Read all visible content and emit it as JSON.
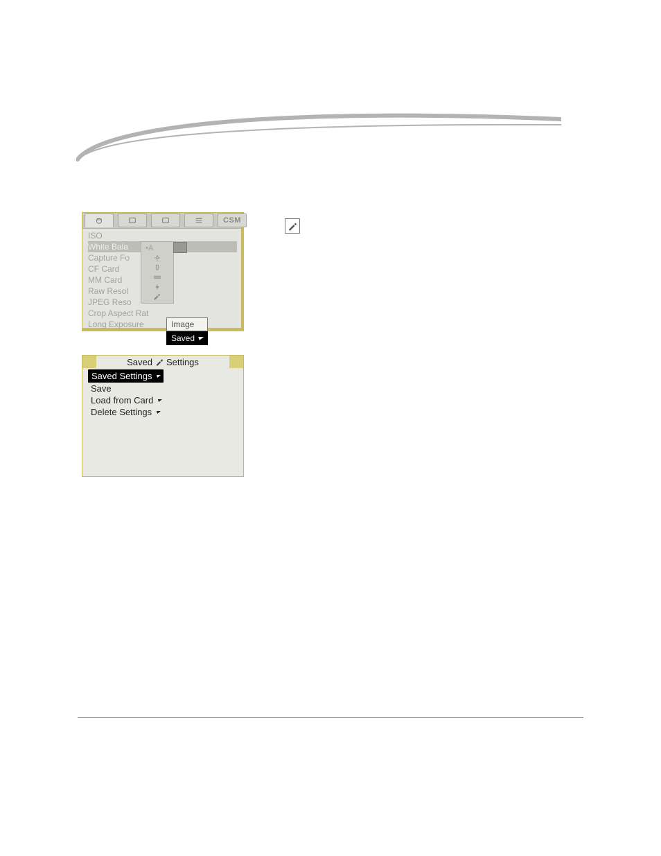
{
  "ss1": {
    "tabs": {
      "csm_label": "CSM"
    },
    "items": {
      "iso": "ISO",
      "white_bal": "White Bala",
      "capture": "Capture Fo",
      "cf_card": "CF Card",
      "mm_card": "MM Card",
      "raw_res": "Raw Resol",
      "jpeg_res": "JPEG Reso",
      "crop": "Crop Aspect Rat",
      "long_exp": "Long Exposure"
    },
    "wb_sub": {
      "auto_label": "A"
    },
    "popup": {
      "image": "Image",
      "saved": "Saved"
    }
  },
  "ss2": {
    "header": {
      "left": "Saved",
      "right": "Settings"
    },
    "items": {
      "saved": "Saved Settings",
      "save": "Save",
      "load": "Load from Card",
      "delete": "Delete Settings"
    }
  },
  "icons": {
    "click_icon": "click-icon",
    "eye_icon": "eye-icon",
    "trash_icon": "trash-icon",
    "sliders_icon": "sliders-icon"
  }
}
